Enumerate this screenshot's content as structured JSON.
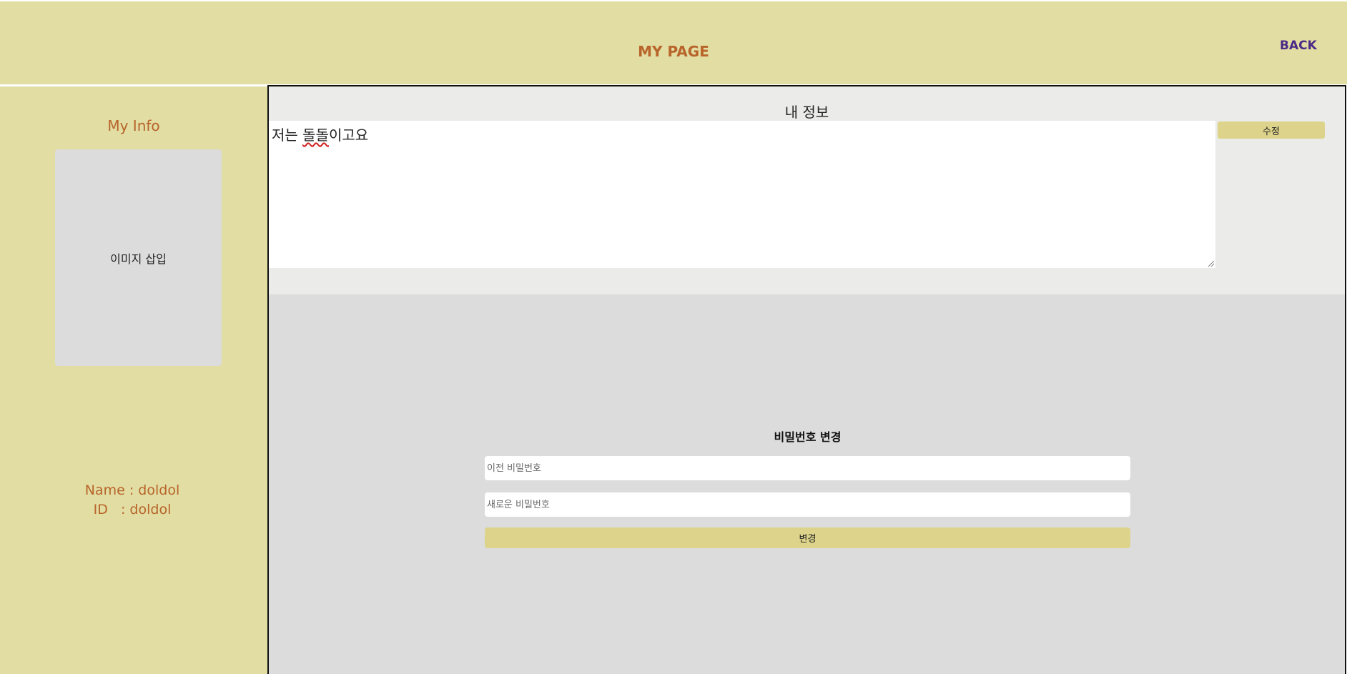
{
  "header": {
    "title": "MY PAGE",
    "back_label": "BACK"
  },
  "sidebar": {
    "title": "My Info",
    "image_placeholder": "이미지 삽입",
    "name_line": "Name : doldol",
    "id_line": "ID   : doldol"
  },
  "info": {
    "title": "내 정보",
    "bio_prefix": "저는 ",
    "bio_underlined": "돌돌",
    "bio_suffix": "이고요",
    "edit_label": "수정"
  },
  "password": {
    "title": "비밀번호 변경",
    "old_placeholder": "이전 비밀번호",
    "new_placeholder": "새로운 비밀번호",
    "submit_label": "변경"
  },
  "colors": {
    "header_bg": "#e1dda3",
    "accent_text": "#b8642a",
    "link": "#4a2a86",
    "button_bg": "#ddd38a"
  }
}
